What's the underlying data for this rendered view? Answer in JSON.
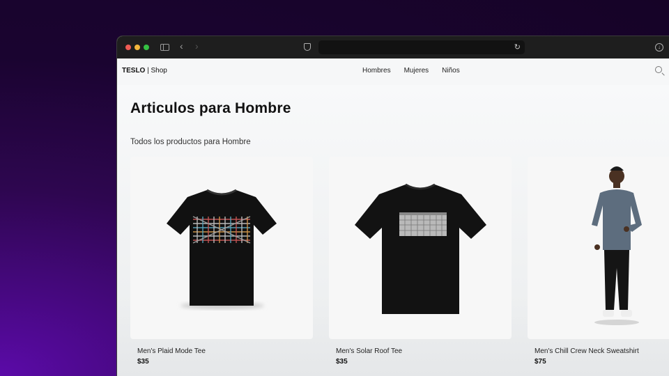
{
  "brand": {
    "name": "TESLO",
    "suffix": "| Shop"
  },
  "nav": {
    "links": [
      "Hombres",
      "Mujeres",
      "Niños"
    ]
  },
  "page": {
    "title": "Articulos para Hombre",
    "subtitle": "Todos los productos para Hombre"
  },
  "products": [
    {
      "name": "Men's Plaid Mode Tee",
      "price": "$35"
    },
    {
      "name": "Men's Solar Roof Tee",
      "price": "$35"
    },
    {
      "name": "Men's Chill Crew Neck Sweatshirt",
      "price": "$75"
    }
  ],
  "icons": {
    "search": "search-icon",
    "shield": "shield-icon",
    "reload": "reload-icon",
    "download": "download-icon",
    "sidebar": "sidebar-toggle-icon",
    "back": "chevron-left-icon",
    "forward": "chevron-right-icon"
  },
  "colors": {
    "background": "#2e0650",
    "accent": "#5b0aa8",
    "toolbar": "#1e1e1e",
    "close": "#ee5b54",
    "minimize": "#f2b63c",
    "maximize": "#35c143"
  }
}
